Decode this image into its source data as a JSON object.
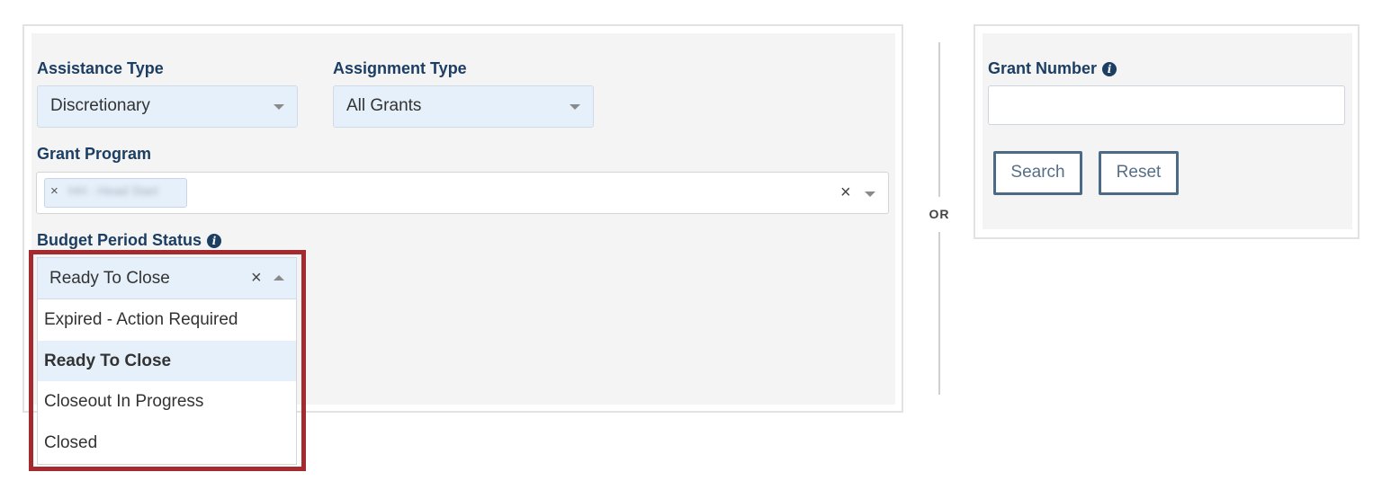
{
  "filters": {
    "assistance_type": {
      "label": "Assistance Type",
      "value": "Discretionary"
    },
    "assignment_type": {
      "label": "Assignment Type",
      "value": "All Grants"
    },
    "grant_program": {
      "label": "Grant Program",
      "chip_text": "HH - Head Start"
    },
    "budget_period_status": {
      "label": "Budget Period Status",
      "value": "Ready To Close",
      "options": [
        "Expired - Action Required",
        "Ready To Close",
        "Closeout In Progress",
        "Closed"
      ],
      "selected_index": 1
    }
  },
  "separator": {
    "text": "OR"
  },
  "grant_search": {
    "label": "Grant Number",
    "input_value": "",
    "search_label": "Search",
    "reset_label": "Reset"
  },
  "icons": {
    "info": "info-circle-icon",
    "caret_down": "caret-down-icon",
    "caret_up": "caret-up-icon",
    "clear": "close-icon"
  },
  "colors": {
    "label": "#1c3e63",
    "select_bg": "#e6f0fb",
    "highlight_border": "#a42a30",
    "panel_bg": "#f4f4f4",
    "button_border": "#4b6a85"
  }
}
